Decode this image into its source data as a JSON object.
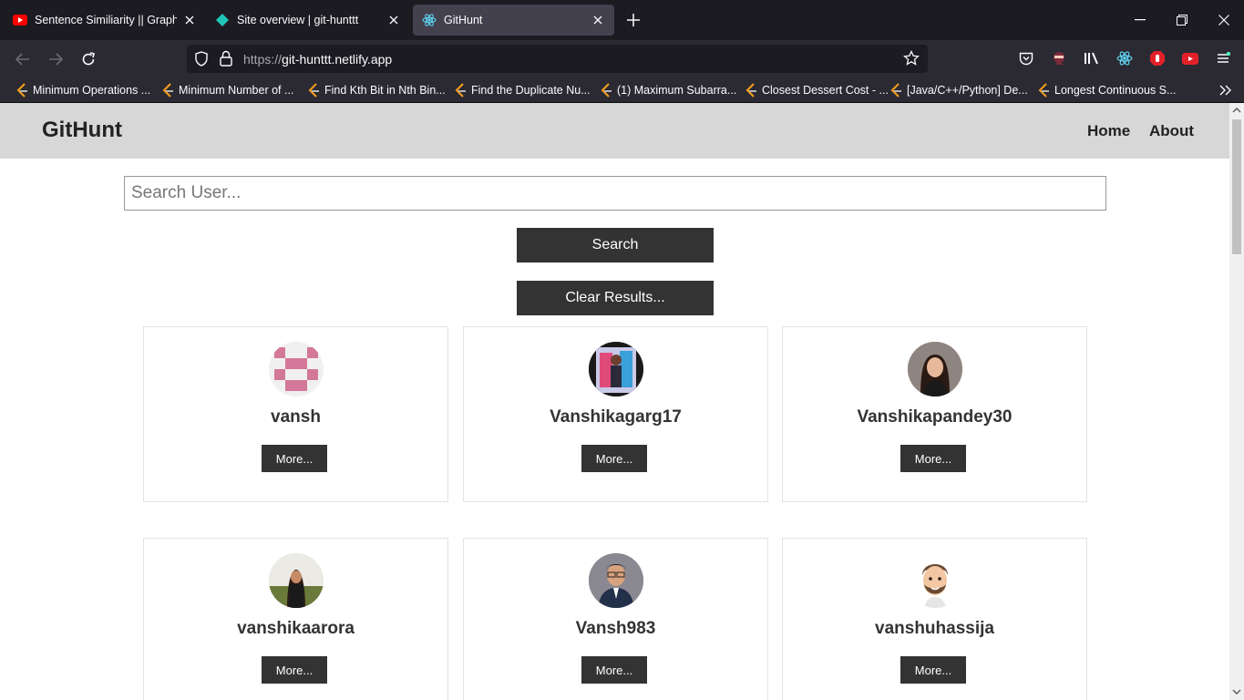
{
  "browser": {
    "tabs": [
      {
        "title": "Sentence Similiarity || Graph the",
        "icon": "youtube-icon"
      },
      {
        "title": "Site overview | git-hunttt",
        "icon": "netlify-icon"
      },
      {
        "title": "GitHunt",
        "icon": "react-icon"
      }
    ],
    "url_scheme": "https://",
    "url_host": "git-hunttt.netlify.app",
    "bookmarks": [
      "Minimum Operations ...",
      "Minimum Number of ...",
      "Find Kth Bit in Nth Bin...",
      "Find the Duplicate Nu...",
      "(1) Maximum Subarra...",
      "Closest Dessert Cost - ...",
      "[Java/C++/Python] De...",
      "Longest Continuous S..."
    ]
  },
  "site": {
    "brand": "GitHunt",
    "nav": {
      "home": "Home",
      "about": "About"
    },
    "search": {
      "placeholder": "Search User...",
      "value": "",
      "button": "Search",
      "clear": "Clear Results..."
    },
    "users": [
      {
        "login": "vansh",
        "more": "More...",
        "avatar": "identicon"
      },
      {
        "login": "Vanshikagarg17",
        "more": "More...",
        "avatar": "photo"
      },
      {
        "login": "Vanshikapandey30",
        "more": "More...",
        "avatar": "photo"
      },
      {
        "login": "vanshikaarora",
        "more": "More...",
        "avatar": "photo"
      },
      {
        "login": "Vansh983",
        "more": "More...",
        "avatar": "photo"
      },
      {
        "login": "vanshuhassija",
        "more": "More...",
        "avatar": "cartoon"
      }
    ]
  },
  "colors": {
    "header_bg": "#d7d7d7",
    "button_bg": "#333333",
    "chrome_dark": "#1c1b22",
    "chrome_mid": "#2b2a33"
  }
}
